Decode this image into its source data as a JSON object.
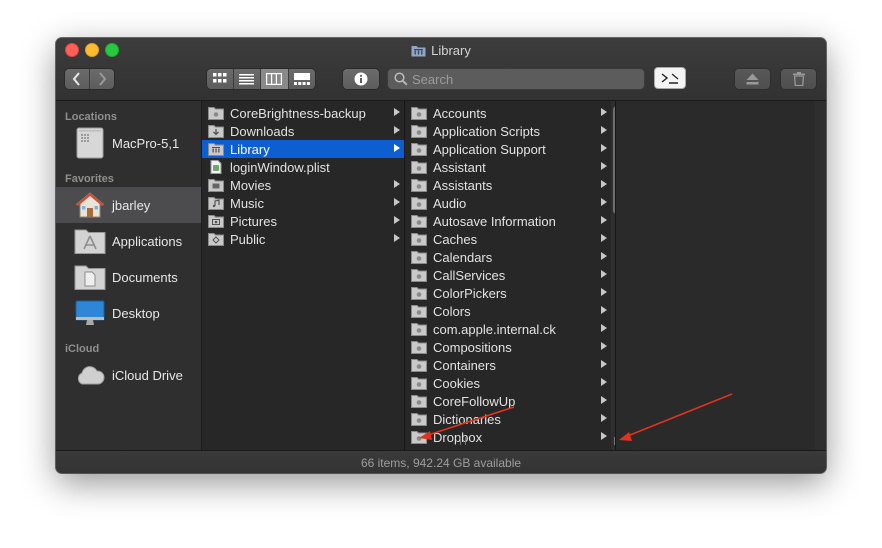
{
  "window": {
    "title": "Library",
    "status": "66 items, 942.24 GB available"
  },
  "toolbar": {
    "search_placeholder": "Search",
    "view_modes": [
      "icon-view",
      "list-view",
      "column-view",
      "gallery-view"
    ],
    "selected_view": "column-view"
  },
  "sidebar": {
    "sections": [
      {
        "header": "Locations",
        "items": [
          {
            "label": "MacPro-5,1",
            "icon": "mac-pro-icon"
          }
        ]
      },
      {
        "header": "Favorites",
        "items": [
          {
            "label": "jbarley",
            "icon": "home-folder-icon",
            "selected": true
          },
          {
            "label": "Applications",
            "icon": "applications-folder-icon"
          },
          {
            "label": "Documents",
            "icon": "documents-folder-icon"
          },
          {
            "label": "Desktop",
            "icon": "desktop-icon"
          }
        ]
      },
      {
        "header": "iCloud",
        "items": [
          {
            "label": "iCloud Drive",
            "icon": "cloud-icon"
          }
        ]
      }
    ]
  },
  "columns": {
    "col1": [
      {
        "label": "CoreBrightness-backup",
        "icon": "folder-icon",
        "arrow": true
      },
      {
        "label": "Downloads",
        "icon": "downloads-folder-icon",
        "arrow": true
      },
      {
        "label": "Library",
        "icon": "library-folder-icon",
        "arrow": true,
        "selected": true
      },
      {
        "label": "loginWindow.plist",
        "icon": "plist-file-icon",
        "arrow": false
      },
      {
        "label": "Movies",
        "icon": "movies-folder-icon",
        "arrow": true
      },
      {
        "label": "Music",
        "icon": "music-folder-icon",
        "arrow": true
      },
      {
        "label": "Pictures",
        "icon": "pictures-folder-icon",
        "arrow": true
      },
      {
        "label": "Public",
        "icon": "public-folder-icon",
        "arrow": true
      }
    ],
    "col2": [
      "Accounts",
      "Application Scripts",
      "Application Support",
      "Assistant",
      "Assistants",
      "Audio",
      "Autosave Information",
      "Caches",
      "Calendars",
      "CallServices",
      "ColorPickers",
      "Colors",
      "com.apple.internal.ck",
      "Compositions",
      "Containers",
      "Cookies",
      "CoreFollowUp",
      "Dictionaries",
      "Dropbox"
    ]
  },
  "colors": {
    "selection": "#0d5fd1",
    "annotation_arrow": "#e0341f"
  }
}
